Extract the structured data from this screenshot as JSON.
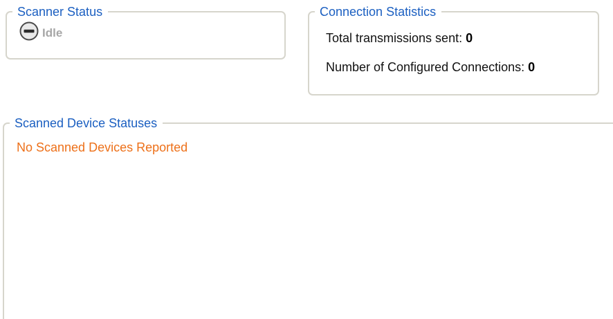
{
  "scanner_status": {
    "title": "Scanner Status",
    "state_label": "Idle",
    "state_icon": "minus-circle-icon"
  },
  "connection_statistics": {
    "title": "Connection Statistics",
    "total_transmissions_label": "Total transmissions sent:",
    "total_transmissions_value": "0",
    "configured_connections_label": "Number of Configured Connections:",
    "configured_connections_value": "0"
  },
  "scanned_device_statuses": {
    "title": "Scanned Device Statuses",
    "empty_message": "No Scanned Devices Reported"
  },
  "colors": {
    "group_title": "#1b5fc1",
    "group_border": "#d6d5cc",
    "idle_text": "#a7a7a7",
    "empty_message": "#ed7019"
  }
}
